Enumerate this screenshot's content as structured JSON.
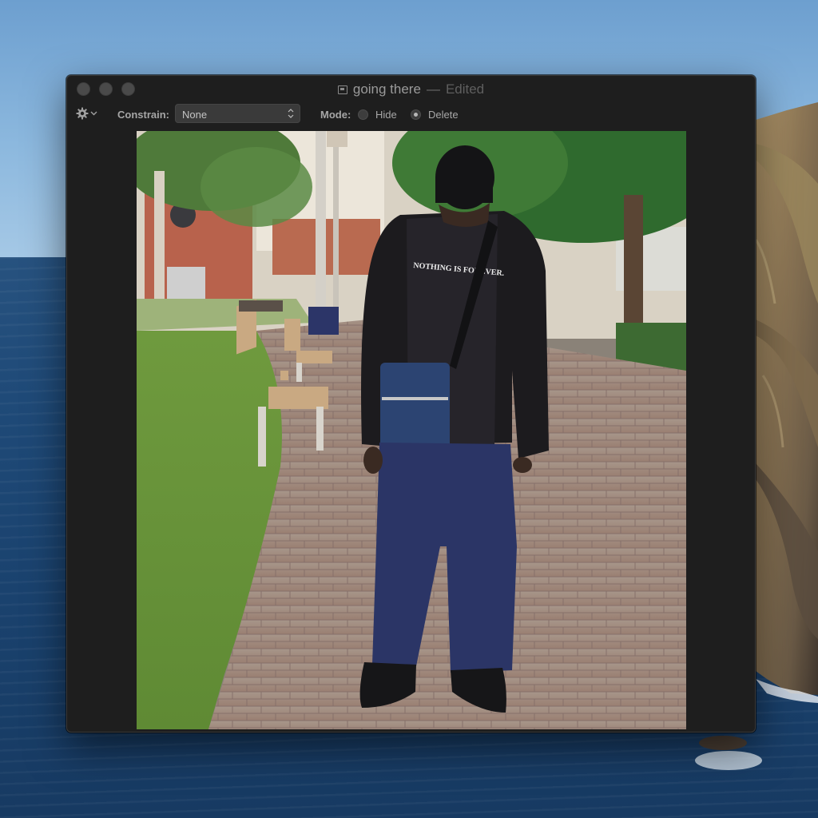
{
  "window": {
    "title": "going there",
    "separator": "—",
    "edited_label": "Edited"
  },
  "toolbar": {
    "gear_icon": "gear-icon",
    "constrain_label": "Constrain:",
    "constrain_value": "None",
    "mode_label": "Mode:",
    "mode_options": [
      {
        "label": "Hide",
        "selected": false
      },
      {
        "label": "Delete",
        "selected": true
      }
    ]
  },
  "photo": {
    "shirt_text": "NOTHING IS FOREVER."
  },
  "colors": {
    "window_bg": "#1e1e1e",
    "titlebar_text": "#9a9a9a",
    "edited_text": "#5f5f5f",
    "sea": "#1f4a78",
    "sky": "#8cb8de"
  }
}
